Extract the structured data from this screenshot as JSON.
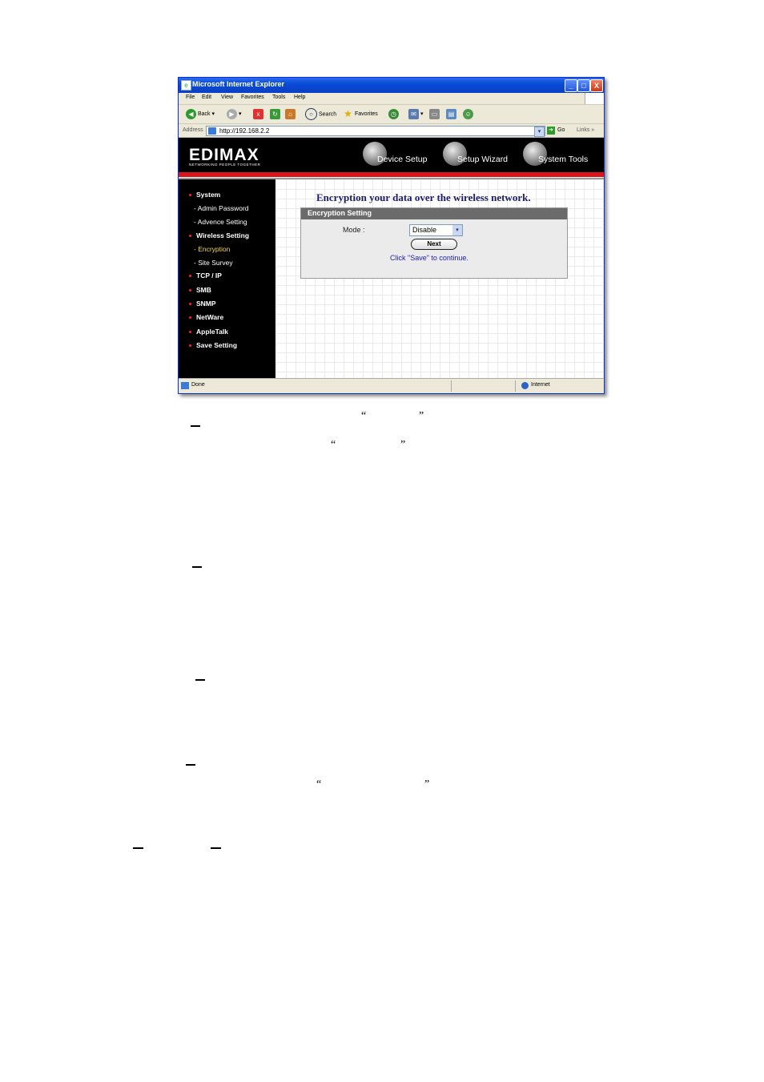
{
  "window": {
    "title": "Microsoft Internet Explorer",
    "controls": {
      "minimize": "_",
      "maximize": "□",
      "close": "X"
    }
  },
  "menubar": [
    "File",
    "Edit",
    "View",
    "Favorites",
    "Tools",
    "Help"
  ],
  "toolbar": {
    "back": "Back",
    "search": "Search",
    "favorites": "Favorites"
  },
  "addressbar": {
    "label": "Address",
    "url": "http://192.168.2.2",
    "go": "Go",
    "links": "Links"
  },
  "header": {
    "logo": "EDIMAX",
    "slogan": "NETWORKING PEOPLE TOGETHER",
    "nav": [
      "Device Setup",
      "Setup Wizard",
      "System Tools"
    ]
  },
  "sidebar": {
    "items": [
      {
        "label": "System",
        "level": "main"
      },
      {
        "label": "- Admin Password",
        "level": "sub"
      },
      {
        "label": "- Advence Setting",
        "level": "sub"
      },
      {
        "label": "Wireless Setting",
        "level": "main"
      },
      {
        "label": "- Encryption",
        "level": "sub",
        "active": true
      },
      {
        "label": "- Site Survey",
        "level": "sub"
      },
      {
        "label": "TCP / IP",
        "level": "main"
      },
      {
        "label": "SMB",
        "level": "main"
      },
      {
        "label": "SNMP",
        "level": "main"
      },
      {
        "label": "NetWare",
        "level": "main"
      },
      {
        "label": "AppleTalk",
        "level": "main"
      },
      {
        "label": "Save Setting",
        "level": "main"
      }
    ]
  },
  "content": {
    "heading": "Encryption your data over the wireless network.",
    "panel_title": "Encryption Setting",
    "mode_label": "Mode :",
    "mode_value": "Disable",
    "next_button": "Next",
    "hint": "Click \"Save\" to continue."
  },
  "statusbar": {
    "left": "Done",
    "right": "Internet"
  },
  "page_marks": {
    "open_quote": "“",
    "close_quote": "”"
  },
  "colors": {
    "accent_red": "#d9151b",
    "heading_blue": "#1d1b6e",
    "active_yellow": "#f5d83a"
  }
}
